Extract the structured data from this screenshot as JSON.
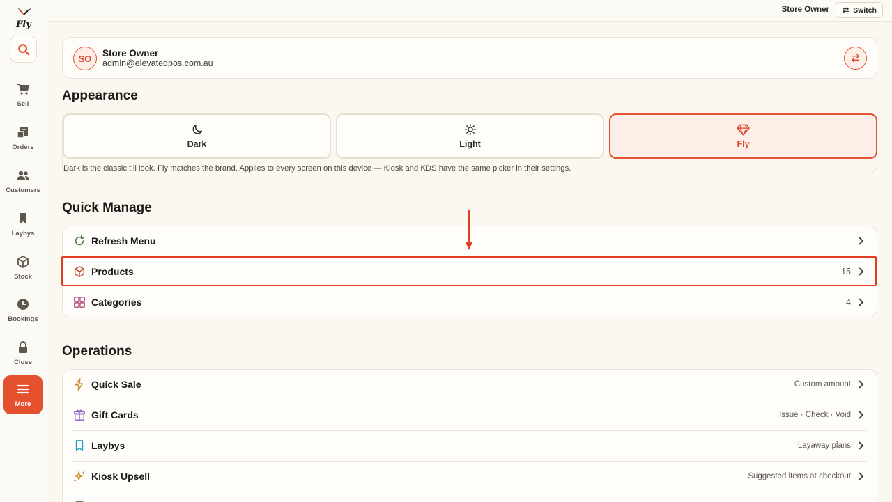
{
  "app": {
    "logo_text": "Fly"
  },
  "sidebar": {
    "items": [
      {
        "label": "Sell",
        "icon": "cart-icon"
      },
      {
        "label": "Orders",
        "icon": "receipt-icon"
      },
      {
        "label": "Customers",
        "icon": "users-icon"
      },
      {
        "label": "Laybys",
        "icon": "bookmark-icon"
      },
      {
        "label": "Stock",
        "icon": "box-icon"
      },
      {
        "label": "Bookings",
        "icon": "clock-icon"
      },
      {
        "label": "Close",
        "icon": "lock-icon"
      },
      {
        "label": "More",
        "icon": "menu-icon",
        "active": true
      }
    ]
  },
  "topbar": {
    "user": "Store Owner",
    "switch_label": "Switch"
  },
  "profile": {
    "initials": "SO",
    "name": "Store Owner",
    "email": "admin@elevatedpos.com.au"
  },
  "appearance": {
    "title": "Appearance",
    "options": [
      {
        "label": "Dark",
        "icon": "moon-icon"
      },
      {
        "label": "Light",
        "icon": "sun-icon"
      },
      {
        "label": "Fly",
        "icon": "diamond-icon",
        "selected": true
      }
    ],
    "hint": "Dark is the classic till look. Fly matches the brand. Applies to every screen on this device — Kiosk and KDS have the same picker in their settings."
  },
  "quick_manage": {
    "title": "Quick Manage",
    "rows": [
      {
        "label": "Refresh Menu",
        "icon": "refresh-icon",
        "value": ""
      },
      {
        "label": "Products",
        "icon": "box-icon",
        "value": "15"
      },
      {
        "label": "Categories",
        "icon": "grid-icon",
        "value": "4"
      }
    ]
  },
  "operations": {
    "title": "Operations",
    "rows": [
      {
        "label": "Quick Sale",
        "icon": "bolt-icon",
        "value": "Custom amount"
      },
      {
        "label": "Gift Cards",
        "icon": "gift-icon",
        "value": "Issue · Check · Void"
      },
      {
        "label": "Laybys",
        "icon": "bookmark-icon",
        "value": "Layaway plans"
      },
      {
        "label": "Kiosk Upsell",
        "icon": "sparkles-icon",
        "value": "Suggested items at checkout"
      }
    ]
  },
  "colors": {
    "accent": "#e5502f",
    "background": "#fbf8f1",
    "card": "#fffdf9"
  }
}
